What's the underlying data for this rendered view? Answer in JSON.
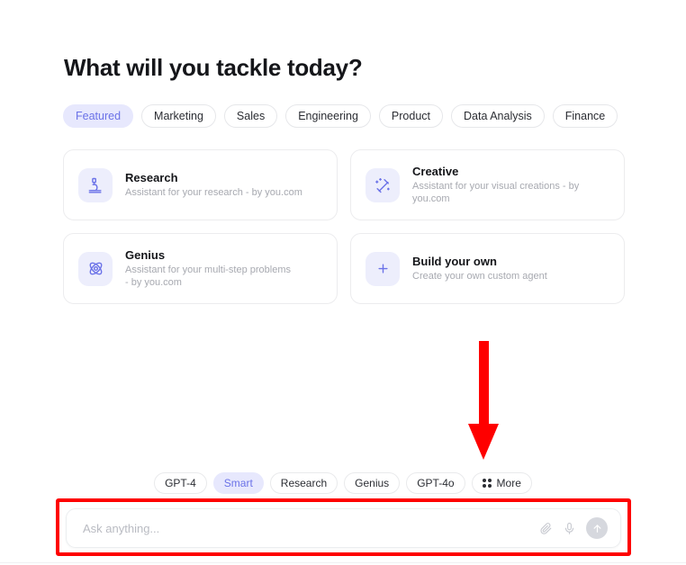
{
  "header": {
    "title": "What will you tackle today?"
  },
  "categories": {
    "active": "Featured",
    "items": [
      {
        "label": "Featured",
        "selected": true
      },
      {
        "label": "Marketing",
        "selected": false
      },
      {
        "label": "Sales",
        "selected": false
      },
      {
        "label": "Engineering",
        "selected": false
      },
      {
        "label": "Product",
        "selected": false
      },
      {
        "label": "Data Analysis",
        "selected": false
      },
      {
        "label": "Finance",
        "selected": false
      }
    ]
  },
  "cards": [
    {
      "icon": "microscope-icon",
      "title": "Research",
      "description": "Assistant for your research - by you.com"
    },
    {
      "icon": "magic-wand-icon",
      "title": "Creative",
      "description": "Assistant for your visual creations - by you.com"
    },
    {
      "icon": "atom-icon",
      "title": "Genius",
      "description": "Assistant for your multi-step problems - by you.com"
    },
    {
      "icon": "plus-icon",
      "title": "Build your own",
      "description": "Create your own custom agent"
    }
  ],
  "models": {
    "active": "Smart",
    "items": [
      {
        "label": "GPT-4",
        "selected": false,
        "icon": null
      },
      {
        "label": "Smart",
        "selected": true,
        "icon": null
      },
      {
        "label": "Research",
        "selected": false,
        "icon": null
      },
      {
        "label": "Genius",
        "selected": false,
        "icon": null
      },
      {
        "label": "GPT-4o",
        "selected": false,
        "icon": null
      },
      {
        "label": "More",
        "selected": false,
        "icon": "grid-dots-icon"
      }
    ]
  },
  "composer": {
    "placeholder": "Ask anything...",
    "value": "",
    "attach_icon": "paperclip-icon",
    "mic_icon": "microphone-icon",
    "send_icon": "arrow-up-icon"
  },
  "annotations": {
    "arrow": {
      "name": "red-down-arrow",
      "color": "#fe0000",
      "points_to": "Ask anything... input"
    },
    "highlight_box": {
      "name": "red-highlight-box",
      "color": "#fe0000",
      "surrounds": "composer"
    }
  },
  "colors": {
    "accent": "#6b72e8",
    "accent_bg": "#e7e8fd",
    "icon_tile_bg": "#edeefc",
    "annotation": "#fe0000",
    "text_primary": "#15161a",
    "text_muted": "#a7a9b0"
  }
}
